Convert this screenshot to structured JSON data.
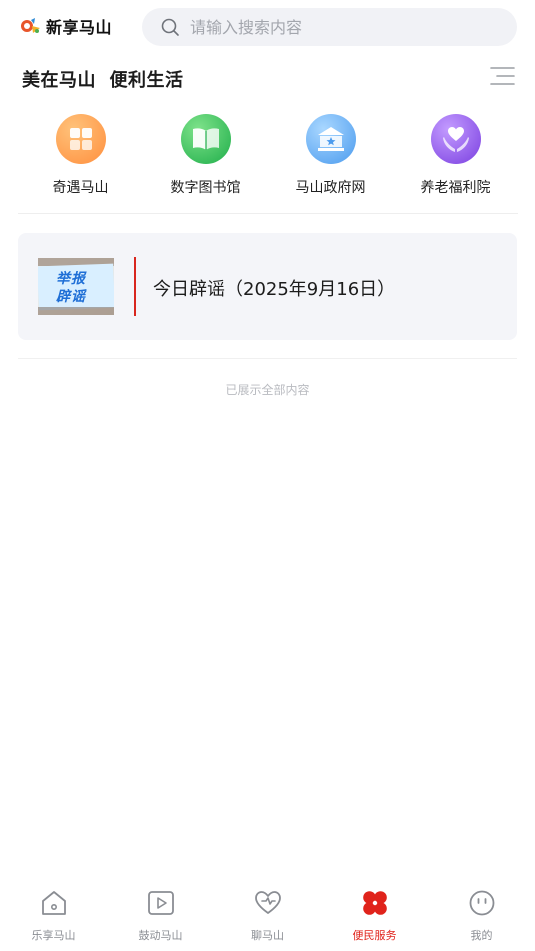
{
  "header": {
    "logo_text": "新享马山",
    "search_placeholder": "请输入搜索内容"
  },
  "section": {
    "title": "美在马山  便利生活"
  },
  "entries": [
    {
      "label": "奇遇马山",
      "icon": "grid-icon",
      "color": "#ff9a4a"
    },
    {
      "label": "数字图书馆",
      "icon": "book-icon",
      "color": "#2fc05a"
    },
    {
      "label": "马山政府网",
      "icon": "government-icon",
      "color": "#5aa8f2"
    },
    {
      "label": "养老福利院",
      "icon": "heart-hands-icon",
      "color": "#8a55e8"
    }
  ],
  "card": {
    "thumb_line1": "举报",
    "thumb_line2": "辟谣",
    "title": "今日辟谣（2025年9月16日）"
  },
  "end_text": "已展示全部内容",
  "tabbar": {
    "active_color": "#e0231b",
    "tabs": [
      {
        "label": "乐享马山",
        "icon": "home-icon",
        "active": false
      },
      {
        "label": "鼓动马山",
        "icon": "play-icon",
        "active": false
      },
      {
        "label": "聊马山",
        "icon": "chat-heart-icon",
        "active": false
      },
      {
        "label": "便民服务",
        "icon": "clover-icon",
        "active": true
      },
      {
        "label": "我的",
        "icon": "smile-icon",
        "active": false
      }
    ]
  }
}
